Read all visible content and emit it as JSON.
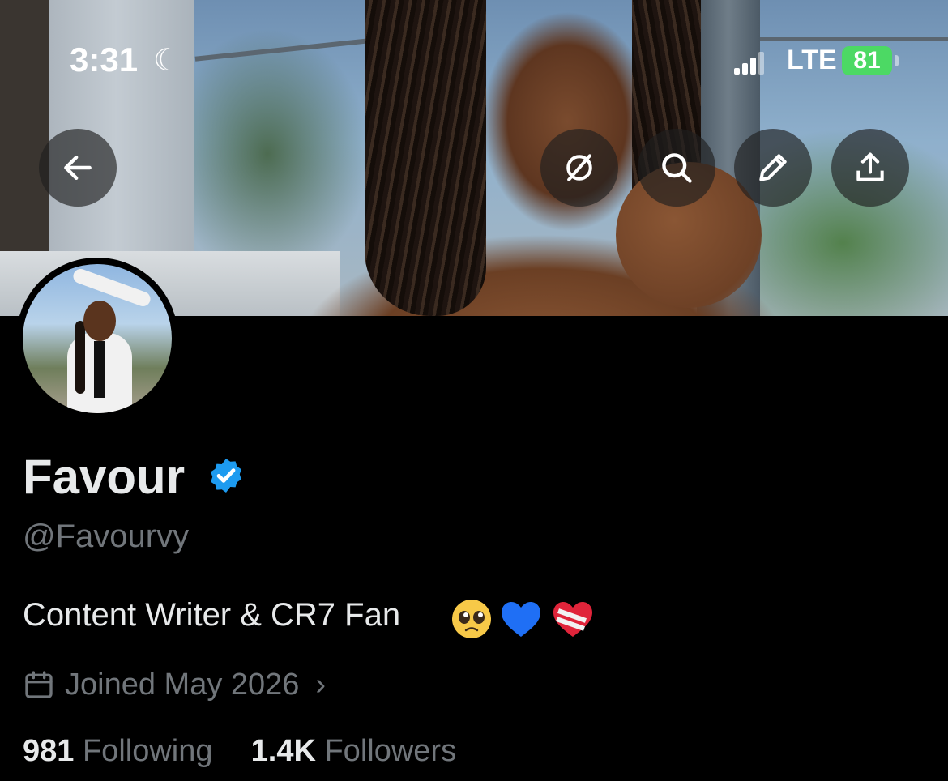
{
  "status_bar": {
    "time": "3:31",
    "moon_icon": "moon-icon",
    "network": "LTE",
    "battery": "81"
  },
  "header_actions": {
    "back_icon": "arrow-left-icon",
    "grok_icon": "grok-icon",
    "search_icon": "search-icon",
    "edit_icon": "pencil-icon",
    "share_icon": "share-icon"
  },
  "profile": {
    "display_name": "Favour",
    "verified": true,
    "handle": "@Favourvy",
    "bio": "Content Writer & CR7 Fan",
    "bio_emojis": [
      "pleading-face",
      "blue-heart",
      "mending-heart"
    ],
    "joined": "Joined May 2026",
    "following_count": "981",
    "following_label": "Following",
    "followers_count": "1.4K",
    "followers_label": "Followers"
  },
  "colors": {
    "background": "#000000",
    "text_primary": "#e7e9ea",
    "text_secondary": "#71767b",
    "verified_blue": "#1d9bf0",
    "battery_green": "#4cd964"
  }
}
